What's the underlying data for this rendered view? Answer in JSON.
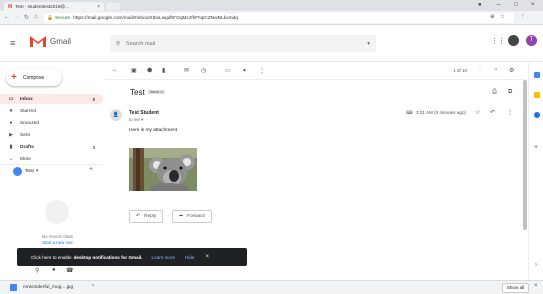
{
  "browser": {
    "tab_title": "Test - studenttest2019@...",
    "secure_label": "Secure",
    "url": "https://mail.google.com/mail/#inbox/KtbxLwgdhFGqMczfhFNpCZNwNLkxmdq"
  },
  "gmail": {
    "logo_text": "Gmail",
    "search_placeholder": "Search mail",
    "compose_label": "Compose",
    "nav": [
      {
        "label": "Inbox",
        "count": "8"
      },
      {
        "label": "Starred",
        "count": ""
      },
      {
        "label": "Snoozed",
        "count": ""
      },
      {
        "label": "Sent",
        "count": ""
      },
      {
        "label": "Drafts",
        "count": "3"
      },
      {
        "label": "More",
        "count": ""
      }
    ],
    "hangouts_user": "Test",
    "no_recent": "No recent chats",
    "start_new": "Start a new one",
    "pager": "1 of 10",
    "colors": {
      "accent": "#ea4335",
      "toast_bg": "#202124",
      "link": "#8ab4f8"
    }
  },
  "message": {
    "subject": "Test",
    "label_chip": "Inbox ×",
    "sender": "Test Student",
    "to": "to me ▾",
    "time": "3:31 AM (0 minutes ago)",
    "body": "Here is my attachment",
    "reply_label": "Reply",
    "forward_label": "Forward"
  },
  "toast": {
    "text": "Click here to enable",
    "bold_text": "desktop notifications for Gmail.",
    "learn_more": "Learn more",
    "hide": "Hide"
  },
  "download": {
    "filename": "mrwonderful_mug....jpg",
    "show_all": "Show all"
  }
}
